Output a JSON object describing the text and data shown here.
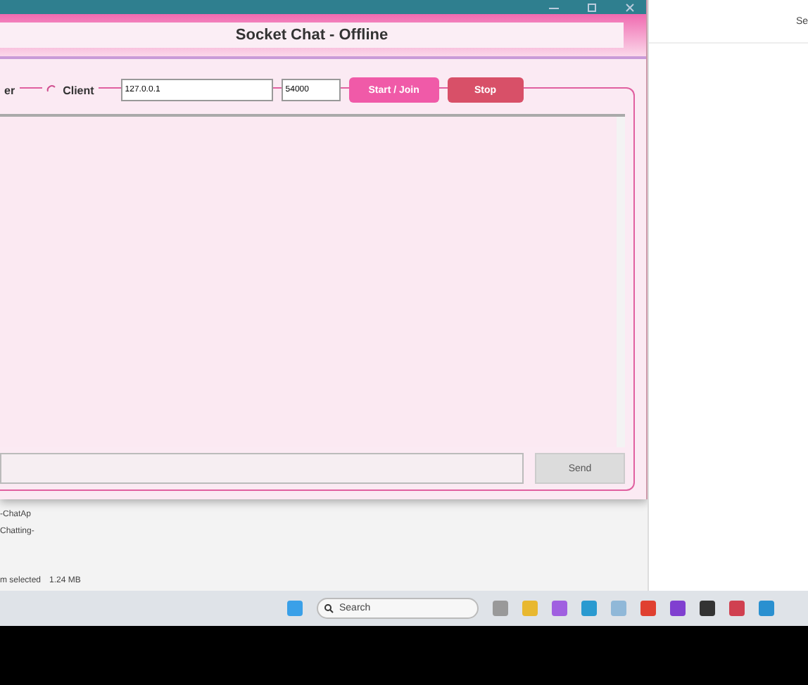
{
  "window": {
    "title": "Socket Chat - Offline"
  },
  "connection": {
    "modes": [
      {
        "label": "er",
        "kind": "plain"
      },
      {
        "label": "Client",
        "kind": "radio"
      }
    ],
    "host": {
      "value": "127.0.0.1"
    },
    "port": {
      "value": "54000"
    },
    "buttons": [
      {
        "label": "Start / Join",
        "kind": "start"
      },
      {
        "label": "Stop",
        "kind": "stop"
      }
    ]
  },
  "chat": {
    "send_button": "Send"
  },
  "explorer": {
    "items": [
      "-ChatAp",
      "Chatting-"
    ],
    "status": [
      "m selected",
      "1.24 MB"
    ],
    "search_text": "Se"
  },
  "taskbar": {
    "search_placeholder": "Search"
  }
}
